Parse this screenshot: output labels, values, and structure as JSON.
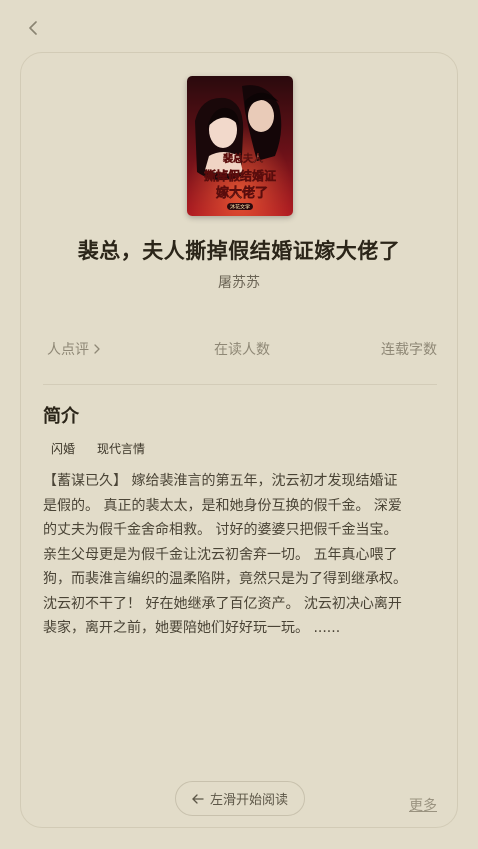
{
  "book": {
    "title": "裴总，夫人撕掉假结婚证嫁大佬了",
    "author": "屠苏苏",
    "cover_text_top": "裴总夫人",
    "cover_text_mid": "撕掉假结婚证",
    "cover_text_bottom": "嫁大佬了",
    "cover_text_pub": "沐花文学"
  },
  "stats": {
    "rating_label": "人点评",
    "readers_label": "在读人数",
    "words_label": "连载字数"
  },
  "intro": {
    "heading": "简介",
    "tags": [
      "闪婚",
      "现代言情"
    ],
    "text": "【蓄谋已久】 嫁给裴淮言的第五年，沈云初才发现结婚证\n是假的。 真正的裴太太，是和她身份互换的假千金。 深爱\n的丈夫为假千金舍命相救。 讨好的婆婆只把假千金当宝。\n亲生父母更是为假千金让沈云初舍弃一切。 五年真心喂了\n狗，而裴淮言编织的温柔陷阱，竟然只是为了得到继承权。\n 沈云初不干了！ 好在她继承了百亿资产。 沈云初决心离开\n裴家，离开之前，她要陪她们好好玩一玩。 ......"
  },
  "actions": {
    "start_reading": "左滑开始阅读",
    "more": "更多"
  }
}
